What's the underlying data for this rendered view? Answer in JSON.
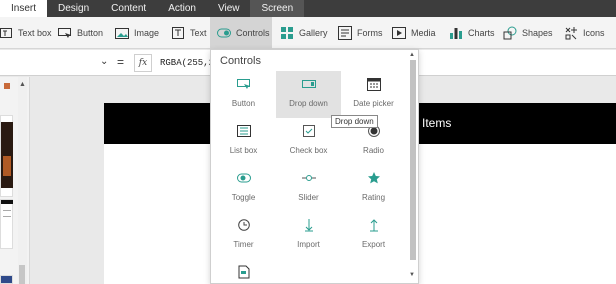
{
  "tabs": [
    {
      "label": "Insert"
    },
    {
      "label": "Design"
    },
    {
      "label": "Content"
    },
    {
      "label": "Action"
    },
    {
      "label": "View"
    },
    {
      "label": "Screen"
    }
  ],
  "ribbon": {
    "textbox": "Text box",
    "button": "Button",
    "image": "Image",
    "text": "Text",
    "controls": "Controls",
    "gallery": "Gallery",
    "forms": "Forms",
    "media": "Media",
    "charts": "Charts",
    "shapes": "Shapes",
    "icons": "Icons"
  },
  "formula": {
    "eq": "=",
    "fx": "fx",
    "value": "RGBA(255,2"
  },
  "canvas": {
    "header_title": "Items"
  },
  "controls_menu": {
    "title": "Controls",
    "items": [
      {
        "label": "Button"
      },
      {
        "label": "Drop down"
      },
      {
        "label": "Date picker"
      },
      {
        "label": "List box"
      },
      {
        "label": "Check box"
      },
      {
        "label": "Radio"
      },
      {
        "label": "Toggle"
      },
      {
        "label": "Slider"
      },
      {
        "label": "Rating"
      },
      {
        "label": "Timer"
      },
      {
        "label": "Import"
      },
      {
        "label": "Export"
      }
    ]
  },
  "tooltip": "Drop down",
  "colors": {
    "accent": "#2a9d8f",
    "tabbar": "#3d3d3d"
  }
}
